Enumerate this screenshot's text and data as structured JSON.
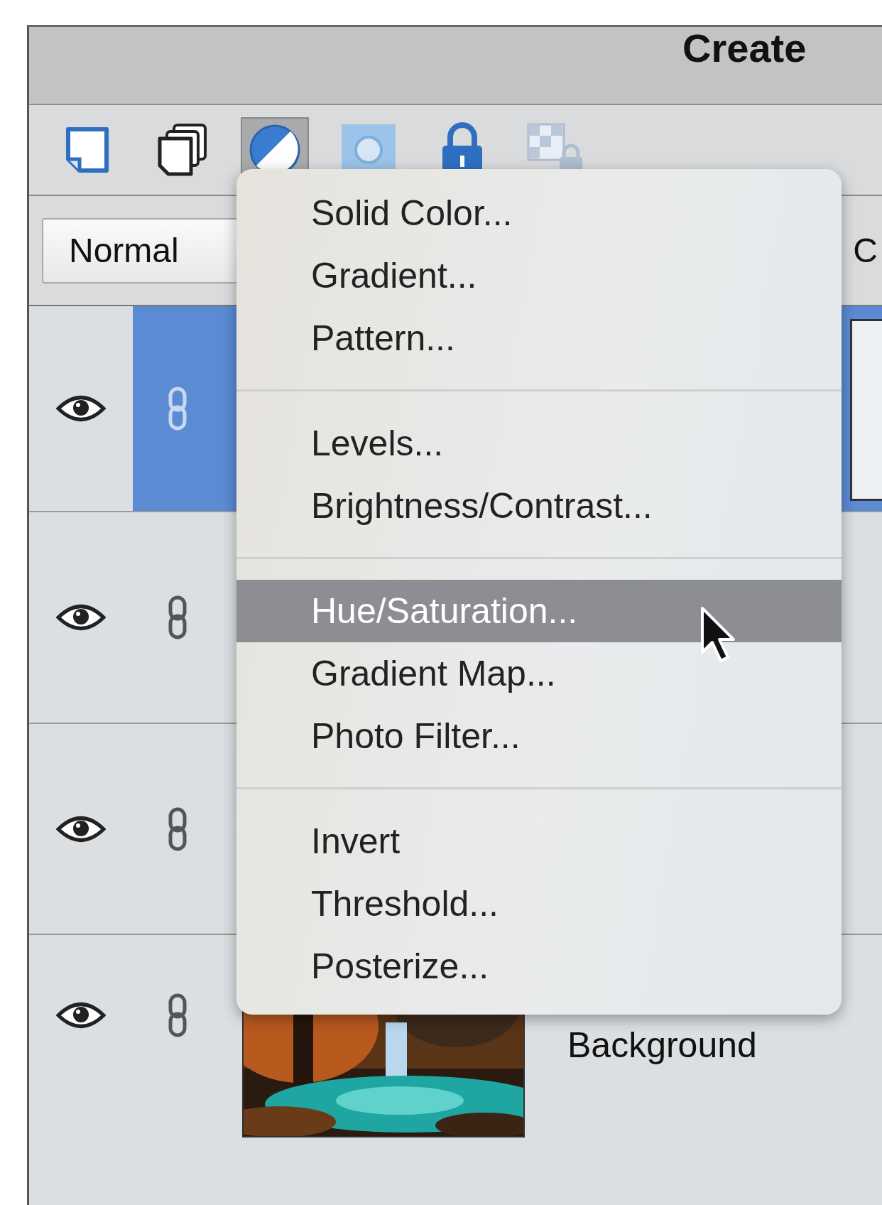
{
  "panel": {
    "title": "Create"
  },
  "toolbar": [
    {
      "kind": "new-layer",
      "selected": false
    },
    {
      "kind": "new-group",
      "selected": false
    },
    {
      "kind": "adjustment",
      "selected": true
    },
    {
      "kind": "mask",
      "selected": false
    },
    {
      "kind": "lock",
      "selected": false
    },
    {
      "kind": "lock-transparency",
      "selected": false
    }
  ],
  "blend_mode": {
    "value": "Normal"
  },
  "opacity_label": "C",
  "layers": [
    {
      "selected": true,
      "visible": true
    },
    {
      "selected": false,
      "visible": true
    },
    {
      "selected": false,
      "visible": true
    },
    {
      "selected": false,
      "visible": true,
      "name": "Background",
      "kind": "picture"
    }
  ],
  "menu": {
    "groups": [
      [
        {
          "label": "Solid Color...",
          "selected": false
        },
        {
          "label": "Gradient...",
          "selected": false
        },
        {
          "label": "Pattern...",
          "selected": false
        }
      ],
      [
        {
          "label": "Levels...",
          "selected": false
        },
        {
          "label": "Brightness/Contrast...",
          "selected": false
        }
      ],
      [
        {
          "label": "Hue/Saturation...",
          "selected": true
        },
        {
          "label": "Gradient Map...",
          "selected": false
        },
        {
          "label": "Photo Filter...",
          "selected": false
        }
      ],
      [
        {
          "label": "Invert",
          "selected": false
        },
        {
          "label": "Threshold...",
          "selected": false
        },
        {
          "label": "Posterize...",
          "selected": false
        }
      ]
    ]
  }
}
